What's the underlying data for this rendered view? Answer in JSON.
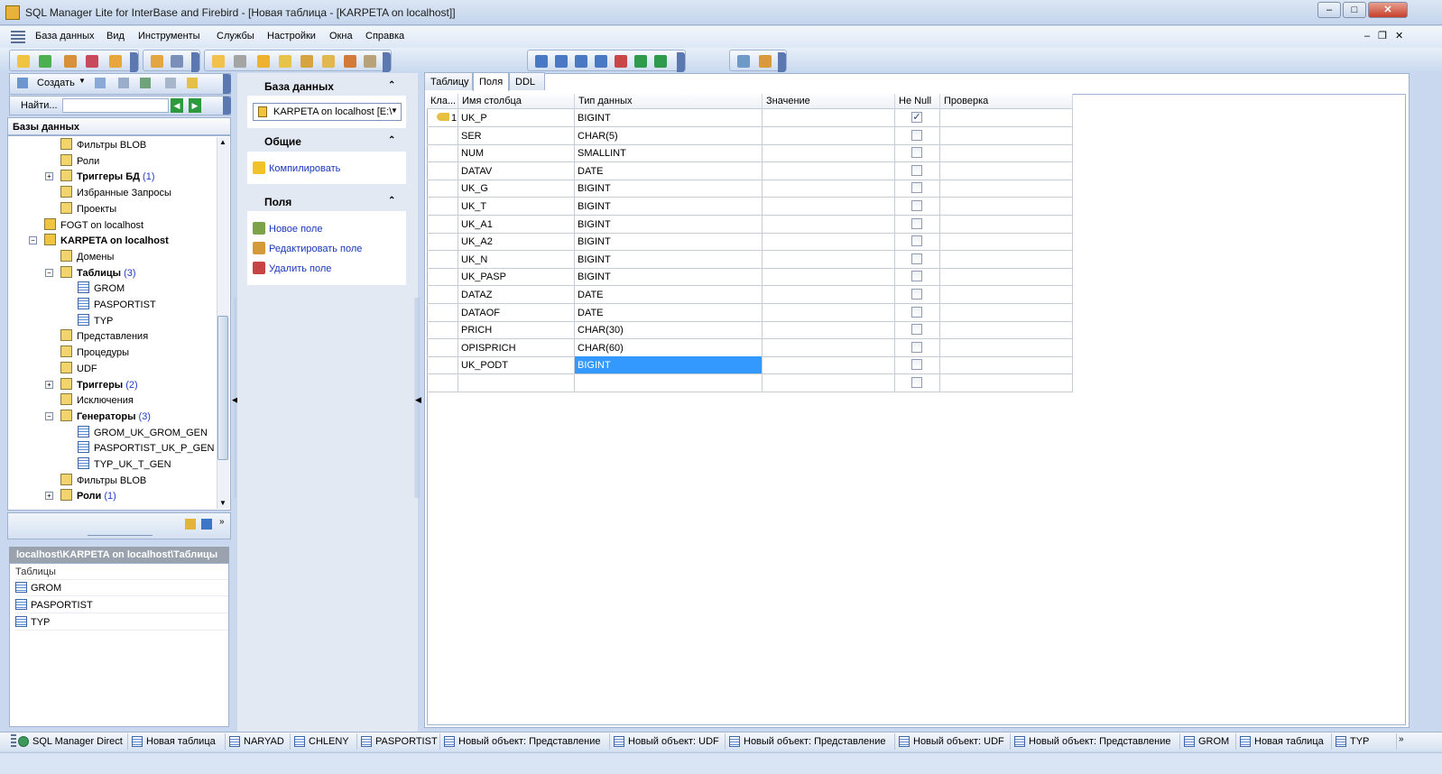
{
  "window": {
    "title": "SQL Manager Lite for InterBase and Firebird - [Новая таблица - [KARPETA on localhost]]"
  },
  "menu": [
    "База данных",
    "Вид",
    "Инструменты",
    "Службы",
    "Настройки",
    "Окна",
    "Справка"
  ],
  "left": {
    "create_label": "Создать",
    "find_label": "Найти...",
    "find_value": "",
    "tree_header": "Базы данных",
    "tree": [
      {
        "label": "Фильтры BLOB",
        "indent": 3,
        "bold": false,
        "count": ""
      },
      {
        "label": "Роли",
        "indent": 3,
        "bold": false,
        "count": ""
      },
      {
        "label": "Триггеры БД",
        "indent": 3,
        "bold": true,
        "count": "(1)",
        "expander": "+"
      },
      {
        "label": "Избранные Запросы",
        "indent": 3,
        "bold": false,
        "count": ""
      },
      {
        "label": "Проекты",
        "indent": 3,
        "bold": false,
        "count": ""
      },
      {
        "label": "FOGT on localhost",
        "indent": 2,
        "bold": false,
        "count": ""
      },
      {
        "label": "KARPETA on localhost",
        "indent": 2,
        "bold": true,
        "count": "",
        "expander": "-"
      },
      {
        "label": "Домены",
        "indent": 3,
        "bold": false,
        "count": ""
      },
      {
        "label": "Таблицы",
        "indent": 3,
        "bold": true,
        "count": "(3)",
        "expander": "-"
      },
      {
        "label": "GROM",
        "indent": 4,
        "bold": false,
        "count": ""
      },
      {
        "label": "PASPORTIST",
        "indent": 4,
        "bold": false,
        "count": ""
      },
      {
        "label": "TYP",
        "indent": 4,
        "bold": false,
        "count": ""
      },
      {
        "label": "Представления",
        "indent": 3,
        "bold": false,
        "count": ""
      },
      {
        "label": "Процедуры",
        "indent": 3,
        "bold": false,
        "count": ""
      },
      {
        "label": "UDF",
        "indent": 3,
        "bold": false,
        "count": ""
      },
      {
        "label": "Триггеры",
        "indent": 3,
        "bold": true,
        "count": "(2)",
        "expander": "+"
      },
      {
        "label": "Исключения",
        "indent": 3,
        "bold": false,
        "count": ""
      },
      {
        "label": "Генераторы",
        "indent": 3,
        "bold": true,
        "count": "(3)",
        "expander": "-"
      },
      {
        "label": "GROM_UK_GROM_GEN",
        "indent": 4,
        "bold": false,
        "count": ""
      },
      {
        "label": "PASPORTIST_UK_P_GEN",
        "indent": 4,
        "bold": false,
        "count": ""
      },
      {
        "label": "TYP_UK_T_GEN",
        "indent": 4,
        "bold": false,
        "count": ""
      },
      {
        "label": "Фильтры BLOB",
        "indent": 3,
        "bold": false,
        "count": ""
      },
      {
        "label": "Роли",
        "indent": 3,
        "bold": true,
        "count": "(1)",
        "expander": "+"
      }
    ],
    "path_header": "localhost\\KARPETA on localhost\\Таблицы",
    "path_list_header": "Таблицы",
    "path_list": [
      "GROM",
      "PASPORTIST",
      "TYP"
    ]
  },
  "mid": {
    "db_section": "База данных",
    "db_value": "KARPETA on localhost [E:\\",
    "general_section": "Общие",
    "compile": "Компилировать",
    "fields_section": "Поля",
    "new_field": "Новое поле",
    "edit_field": "Редактировать поле",
    "delete_field": "Удалить поле"
  },
  "tabs": [
    "Таблицу",
    "Поля",
    "DDL"
  ],
  "grid": {
    "columns": [
      "Кла...",
      "Имя столбца",
      "Тип данных",
      "Значение",
      "Не Null",
      "Проверка"
    ],
    "rows": [
      {
        "key": "1",
        "name": "UK_P",
        "type": "BIGINT",
        "value": "",
        "notnull": true,
        "check": ""
      },
      {
        "key": "",
        "name": "SER",
        "type": "CHAR(5)",
        "value": "",
        "notnull": false,
        "check": ""
      },
      {
        "key": "",
        "name": "NUM",
        "type": "SMALLINT",
        "value": "",
        "notnull": false,
        "check": ""
      },
      {
        "key": "",
        "name": "DATAV",
        "type": "DATE",
        "value": "",
        "notnull": false,
        "check": ""
      },
      {
        "key": "",
        "name": "UK_G",
        "type": "BIGINT",
        "value": "",
        "notnull": false,
        "check": ""
      },
      {
        "key": "",
        "name": "UK_T",
        "type": "BIGINT",
        "value": "",
        "notnull": false,
        "check": ""
      },
      {
        "key": "",
        "name": "UK_A1",
        "type": "BIGINT",
        "value": "",
        "notnull": false,
        "check": ""
      },
      {
        "key": "",
        "name": "UK_A2",
        "type": "BIGINT",
        "value": "",
        "notnull": false,
        "check": ""
      },
      {
        "key": "",
        "name": "UK_N",
        "type": "BIGINT",
        "value": "",
        "notnull": false,
        "check": ""
      },
      {
        "key": "",
        "name": "UK_PASP",
        "type": "BIGINT",
        "value": "",
        "notnull": false,
        "check": ""
      },
      {
        "key": "",
        "name": "DATAZ",
        "type": "DATE",
        "value": "",
        "notnull": false,
        "check": ""
      },
      {
        "key": "",
        "name": "DATAOF",
        "type": "DATE",
        "value": "",
        "notnull": false,
        "check": ""
      },
      {
        "key": "",
        "name": "PRICH",
        "type": "CHAR(30)",
        "value": "",
        "notnull": false,
        "check": ""
      },
      {
        "key": "",
        "name": "OPISPRICH",
        "type": "CHAR(60)",
        "value": "",
        "notnull": false,
        "check": ""
      },
      {
        "key": "",
        "name": "UK_PODT",
        "type": "BIGINT",
        "value": "",
        "notnull": false,
        "check": "",
        "selected": true
      },
      {
        "key": "",
        "name": "",
        "type": "",
        "value": "",
        "notnull": false,
        "check": ""
      }
    ]
  },
  "taskbar": [
    "SQL Manager Direct",
    "Новая таблица",
    "NARYAD",
    "CHLENY",
    "PASPORTIST",
    "Новый объект: Представление",
    "Новый объект: UDF",
    "Новый объект: Представление",
    "Новый объект: UDF",
    "Новый объект: Представление",
    "GROM",
    "Новая таблица",
    "TYP"
  ]
}
